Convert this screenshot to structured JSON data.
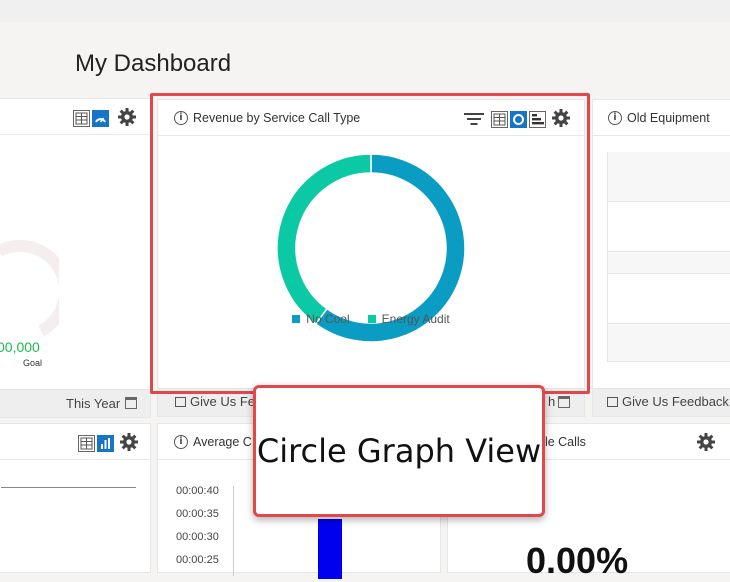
{
  "page": {
    "title": "My Dashboard"
  },
  "left_card": {
    "goal_value": "00,000",
    "goal_label": "Goal",
    "footer": "This Year"
  },
  "revenue_card": {
    "title": "Revenue by Service Call Type",
    "legend": [
      {
        "name": "No Cool",
        "color": "#0b9cc3"
      },
      {
        "name": "Energy Audit",
        "color": "#0bc9a4"
      }
    ],
    "footer_left": "Give Us Fe",
    "footer_right": "h"
  },
  "chart_data": {
    "type": "pie",
    "donut": true,
    "categories": [
      "No Cool",
      "Energy Audit"
    ],
    "values": [
      60,
      40
    ],
    "colors": [
      "#0b9cc3",
      "#0bc9a4"
    ],
    "title": ""
  },
  "old_equipment_card": {
    "title": "Old Equipment",
    "footer": "Give Us Feedback"
  },
  "bottom_left_card": {},
  "avg_card": {
    "title": "Average C",
    "y_ticks": [
      "00:00:40",
      "00:00:35",
      "00:00:30",
      "00:00:25"
    ]
  },
  "bottom_right_card": {
    "title": "ble Calls",
    "value": "0.00%"
  },
  "callout": {
    "label": "Circle Graph View"
  }
}
